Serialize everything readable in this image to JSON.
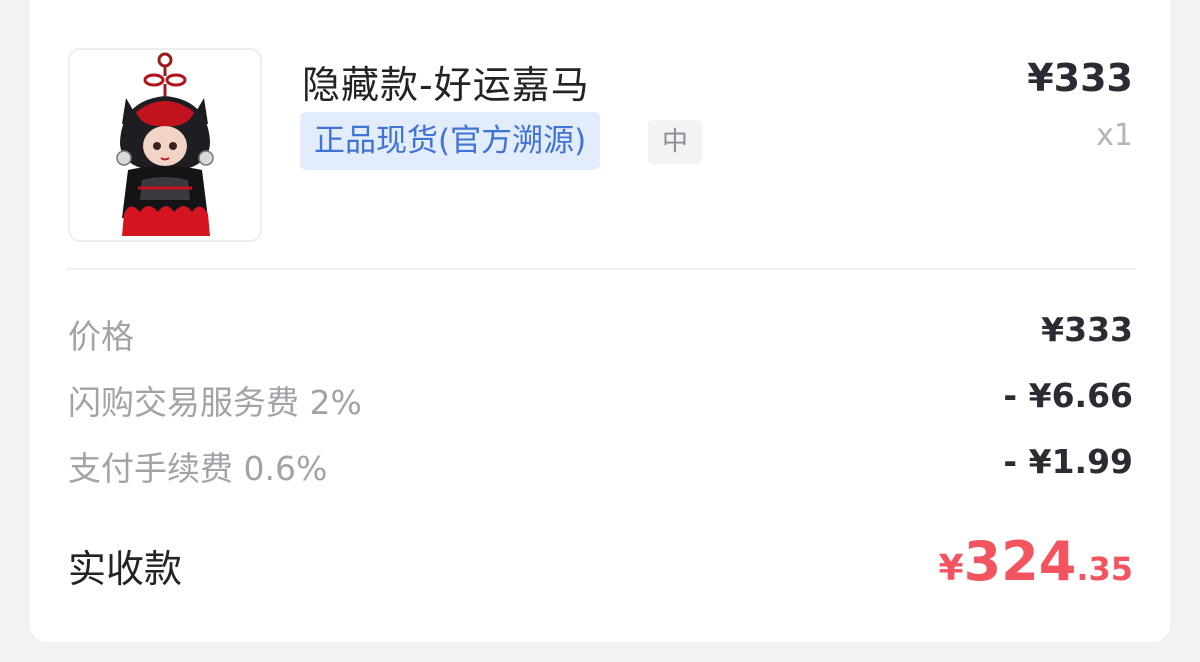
{
  "product": {
    "image_alt": "figurine-keychain",
    "title": "隐藏款-好运嘉马",
    "tag_authentic": "正品现货(官方溯源)",
    "tag_size": "中",
    "unit_price": "¥333",
    "quantity": "x1"
  },
  "fees": {
    "price_label": "价格",
    "price_value": "¥333",
    "service_fee_label": "闪购交易服务费 2%",
    "service_fee_value": "- ¥6.66",
    "payment_fee_label": "支付手续费 0.6%",
    "payment_fee_value": "- ¥1.99"
  },
  "net": {
    "label": "实收款",
    "currency": "¥",
    "integer": "324",
    "decimal": ".35"
  },
  "colors": {
    "accent_red": "#f25560",
    "tag_blue": "#3f73d4",
    "tag_blue_bg": "#e3ecfb"
  }
}
